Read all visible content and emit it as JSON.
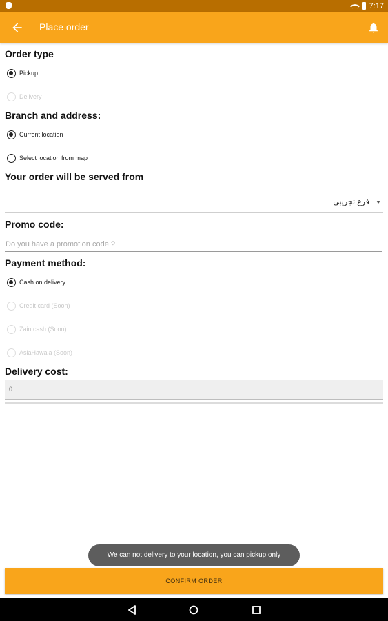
{
  "status_bar": {
    "time": "7:17"
  },
  "app_bar": {
    "title": "Place order"
  },
  "order_type": {
    "title": "Order type",
    "options": [
      {
        "label": "Pickup",
        "checked": true,
        "disabled": false
      },
      {
        "label": "Delivery",
        "checked": false,
        "disabled": true
      }
    ]
  },
  "branch": {
    "title": "Branch and address:",
    "options": [
      {
        "label": "Current location",
        "checked": true,
        "disabled": false
      },
      {
        "label": "Select location from map",
        "checked": false,
        "disabled": false
      }
    ]
  },
  "served_from": {
    "title": "Your order will be served from",
    "selected": "فرع تجريبي"
  },
  "promo": {
    "title": "Promo code:",
    "placeholder": "Do you have a promotion code ?",
    "value": ""
  },
  "payment": {
    "title": "Payment method:",
    "options": [
      {
        "label": "Cash on delivery",
        "checked": true,
        "disabled": false
      },
      {
        "label": "Credit card (Soon)",
        "checked": false,
        "disabled": true
      },
      {
        "label": "Zain cash (Soon)",
        "checked": false,
        "disabled": true
      },
      {
        "label": "AsiaHawala (Soon)",
        "checked": false,
        "disabled": true
      }
    ]
  },
  "delivery_cost": {
    "title": "Delivery cost:",
    "value": "0"
  },
  "toast": {
    "message": "We can not delivery to your location, you can pickup only"
  },
  "confirm_button": {
    "label": "CONFIRM ORDER"
  },
  "colors": {
    "accent": "#f9a51b",
    "status_bar": "#b86e00",
    "toast_bg": "#5d5d5d"
  },
  "icons": {
    "back": "arrow-left-icon",
    "bell": "bell-icon",
    "nav_back": "triangle-back-icon",
    "nav_home": "circle-home-icon",
    "nav_recents": "square-recents-icon"
  }
}
